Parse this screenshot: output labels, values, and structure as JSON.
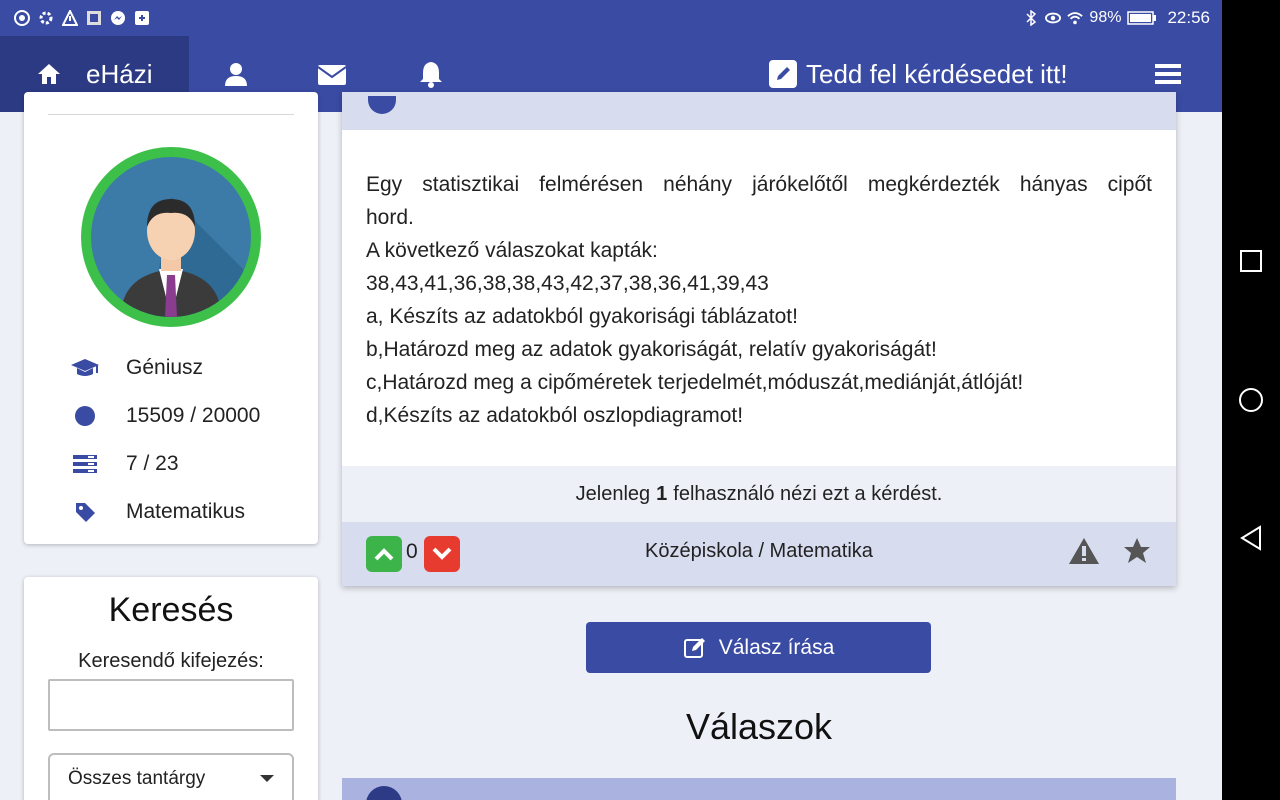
{
  "status_bar": {
    "battery": "98%",
    "time": "22:56",
    "icons": [
      "chrome-icon",
      "settings-gear-icon",
      "warning-icon",
      "app-icon",
      "messenger-icon",
      "download-icon",
      "bluetooth-icon",
      "eye-icon",
      "wifi-icon",
      "battery-icon"
    ]
  },
  "nav": {
    "brand": "eHázi",
    "ask_label": "Tedd fel kérdésedet itt!",
    "icons": [
      "home-icon",
      "user-icon",
      "envelope-icon",
      "bell-icon",
      "edit-icon",
      "hamburger-menu-icon"
    ]
  },
  "profile": {
    "stats": [
      {
        "icon": "graduation-cap-icon",
        "label": "Géniusz"
      },
      {
        "icon": "circle-icon",
        "label": "15509 / 20000"
      },
      {
        "icon": "list-icon",
        "label": "7 / 23"
      },
      {
        "icon": "tag-icon",
        "label": "Matematikus"
      }
    ]
  },
  "search": {
    "title": "Keresés",
    "label": "Keresendő kifejezés:",
    "input_value": "",
    "select_value": "Összes tantárgy"
  },
  "question": {
    "lines": [
      "Egy statisztikai felmérésen néhány járókelőtől megkérdezték hányas cipőt",
      "hord.",
      "A következő válaszokat kapták:",
      "38,43,41,36,38,38,43,42,37,38,36,41,39,43",
      "a, Készíts az adatokból gyakorisági táblázatot!",
      "b,Határozd meg az adatok gyakoriságát, relatív gyakoriságát!",
      "c,Határozd meg a cipőméretek terjedelmét,móduszát,mediánját,átlóját!",
      "d,Készíts az adatokból oszlopdiagramot!"
    ],
    "viewers_prefix": "Jelenleg",
    "viewers_count": "1",
    "viewers_suffix": "felhasználó nézi ezt a kérdést.",
    "votes": "0",
    "category": "Középiskola / Matematika"
  },
  "reply_button": "Válasz írása",
  "answers_title": "Válaszok",
  "colors": {
    "primary": "#3a4ba3",
    "primary_dark": "#2c3a84",
    "green": "#3cb44a",
    "red": "#e63b2e",
    "bg": "#eef0f8"
  }
}
